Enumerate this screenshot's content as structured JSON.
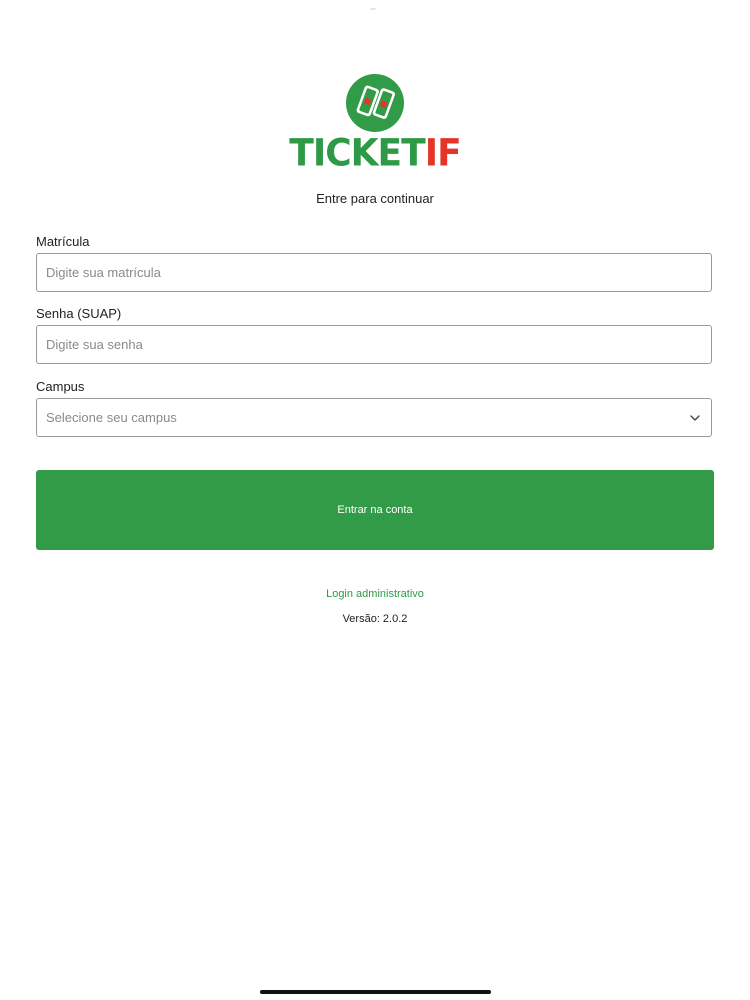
{
  "brand": {
    "name_part1": "TICKET",
    "name_part2": "IF",
    "primary_color": "#2e9a47",
    "accent_color": "#e5352b"
  },
  "subtitle": "Entre para continuar",
  "form": {
    "matricula": {
      "label": "Matrícula",
      "placeholder": "Digite sua matrícula",
      "value": ""
    },
    "senha": {
      "label": "Senha (SUAP)",
      "placeholder": "Digite sua senha",
      "value": ""
    },
    "campus": {
      "label": "Campus",
      "selected": "Selecione seu campus",
      "icon": "chevron-down-icon"
    },
    "submit_label": "Entrar na conta"
  },
  "admin_link": "Login administrativo",
  "version": "Versão: 2.0.2"
}
